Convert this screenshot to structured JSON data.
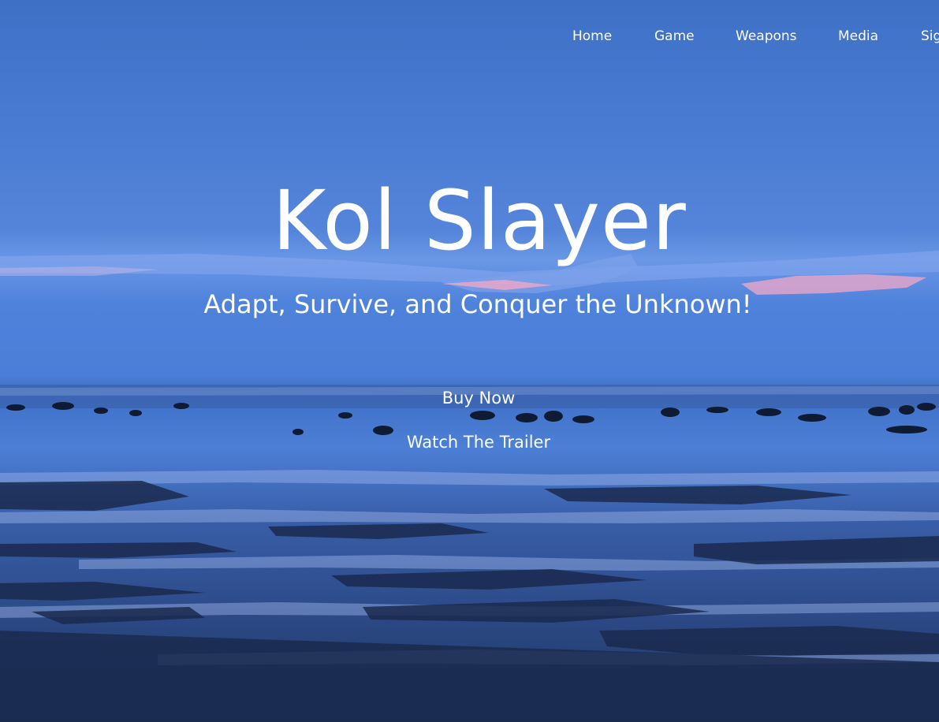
{
  "nav": {
    "items": [
      "Home",
      "Game",
      "Weapons",
      "Media",
      "Sign"
    ]
  },
  "hero": {
    "title": "Kol Slayer",
    "subtitle": "Adapt, Survive, and Conquer the Unknown!",
    "buy_label": "Buy Now",
    "trailer_label": "Watch The Trailer"
  },
  "background": {
    "scene": "coastal-dusk-image",
    "sky_color": "#4a7dd3",
    "cloud_pink": "#e8a6c8",
    "water_color": "#6b96e0",
    "sand_color": "#1c2e55"
  }
}
